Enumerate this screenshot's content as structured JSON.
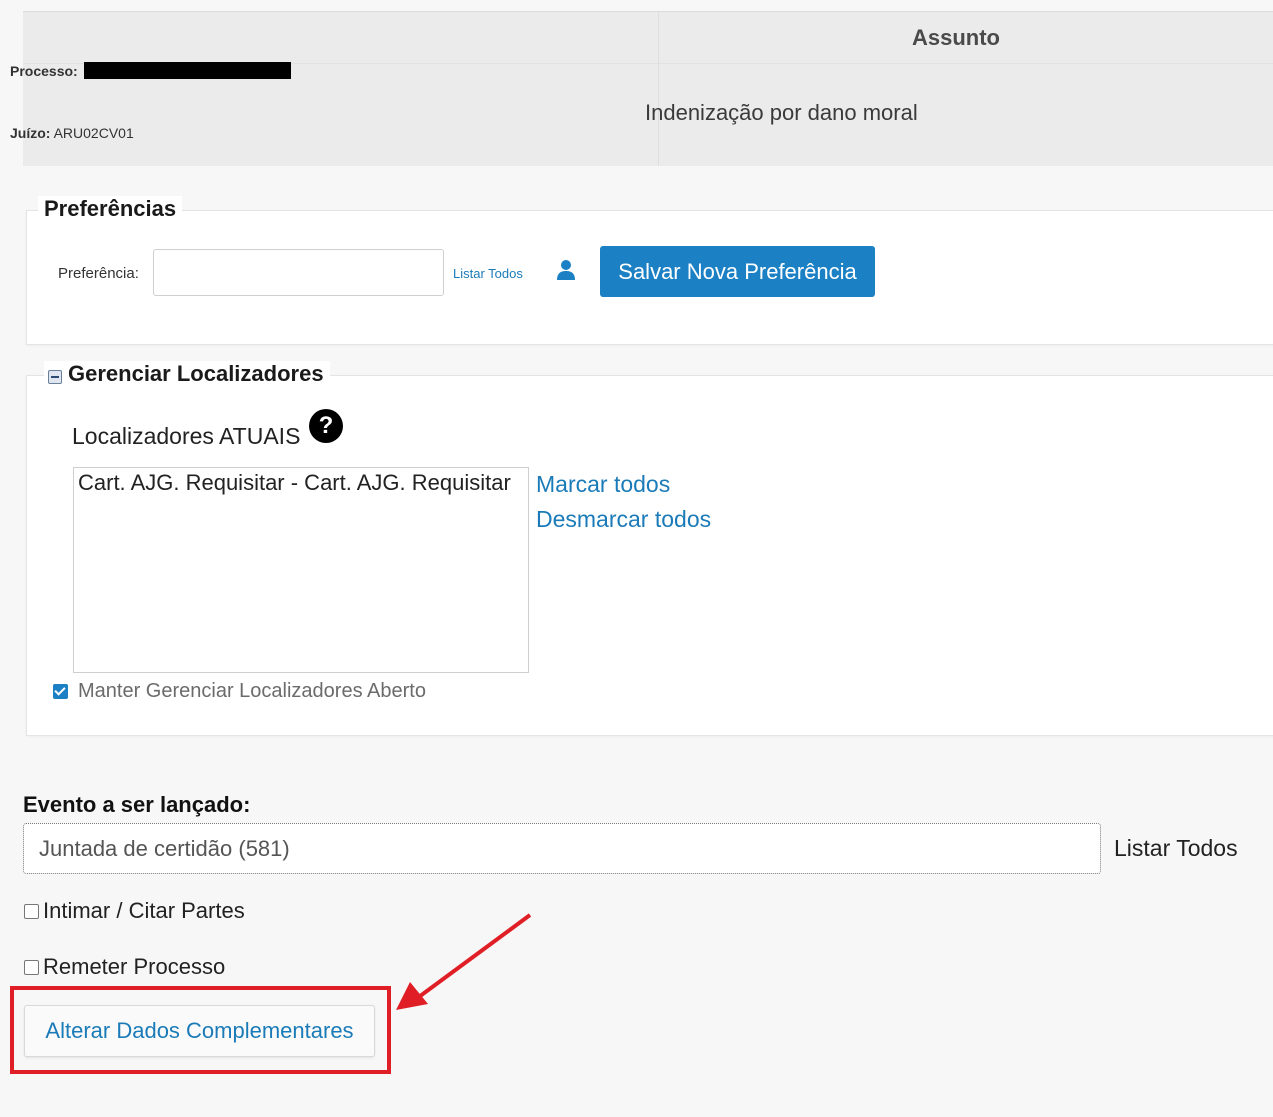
{
  "header": {
    "assunto_header": "Assunto",
    "processo_label": "Processo:",
    "juizo_label": "Juízo:",
    "juizo_value": "ARU02CV01",
    "assunto_value": "Indenização por dano moral"
  },
  "preferencias": {
    "legend": "Preferências",
    "label": "Preferência:",
    "input_value": "",
    "listar_todos": "Listar Todos",
    "save_button": "Salvar Nova Preferência"
  },
  "localizadores": {
    "legend": "Gerenciar Localizadores",
    "title": "Localizadores ATUAIS",
    "help": "?",
    "items": [
      "Cart. AJG. Requisitar - Cart. AJG. Requisitar"
    ],
    "mark_all": "Marcar todos",
    "unmark_all": "Desmarcar todos",
    "keep_open_label": "Manter Gerenciar Localizadores Aberto",
    "keep_open_checked": true
  },
  "evento": {
    "label": "Evento a ser lançado:",
    "value": "Juntada de certidão (581)",
    "listar_todos": "Listar Todos"
  },
  "options": {
    "intimar_label": "Intimar / Citar Partes",
    "remeter_label": "Remeter Processo"
  },
  "actions": {
    "alterar_button": "Alterar Dados Complementares"
  },
  "annotation": {
    "highlight_color": "#e01e25"
  }
}
